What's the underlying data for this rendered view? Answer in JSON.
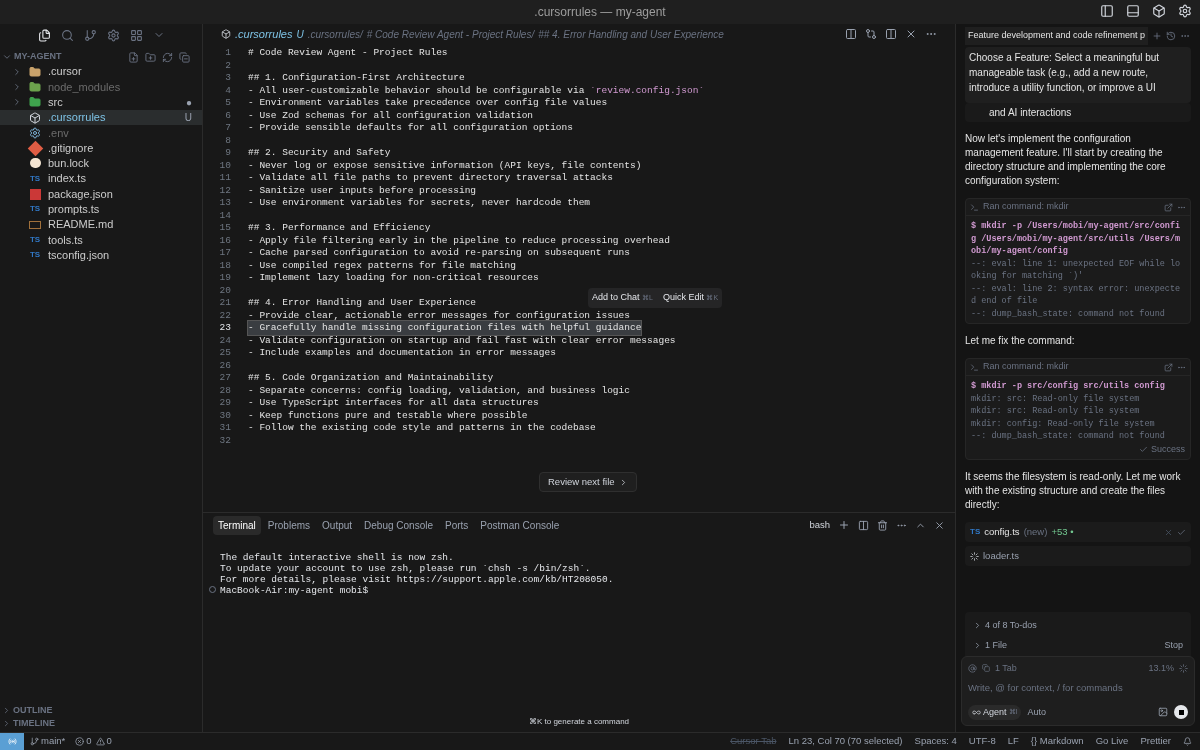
{
  "window": {
    "title": ".cursorrules — my-agent"
  },
  "explorer": {
    "title": "MY-AGENT",
    "items": [
      {
        "name": ".cursor",
        "kind": "folder",
        "selected": false,
        "dimmed": false
      },
      {
        "name": "node_modules",
        "kind": "folder",
        "selected": false,
        "dimmed": true
      },
      {
        "name": "src",
        "kind": "folder",
        "selected": false,
        "dimmed": false,
        "badge": "●"
      },
      {
        "name": ".cursorrules",
        "kind": "file",
        "selected": true,
        "dimmed": false,
        "badge": "U"
      },
      {
        "name": ".env",
        "kind": "file",
        "selected": false,
        "dimmed": true
      },
      {
        "name": ".gitignore",
        "kind": "file",
        "selected": false,
        "dimmed": false
      },
      {
        "name": "bun.lock",
        "kind": "file",
        "selected": false,
        "dimmed": false
      },
      {
        "name": "index.ts",
        "kind": "file",
        "icon_label": "TS",
        "selected": false,
        "dimmed": false
      },
      {
        "name": "package.json",
        "kind": "file",
        "selected": false,
        "dimmed": false
      },
      {
        "name": "prompts.ts",
        "kind": "file",
        "icon_label": "TS",
        "selected": false,
        "dimmed": false
      },
      {
        "name": "README.md",
        "kind": "file",
        "selected": false,
        "dimmed": false
      },
      {
        "name": "tools.ts",
        "kind": "file",
        "icon_label": "TS",
        "selected": false,
        "dimmed": false
      },
      {
        "name": "tsconfig.json",
        "kind": "file",
        "icon_label": "TS",
        "selected": false,
        "dimmed": false
      }
    ],
    "sections": [
      "OUTLINE",
      "TIMELINE"
    ]
  },
  "editor": {
    "tab": {
      "name": ".cursorrules",
      "status": "U"
    },
    "breadcrumb": [
      ".cursorrules/",
      "# Code Review Agent - Project Rules/",
      "## 4. Error Handling and User Experience"
    ],
    "lines": [
      {
        "n": "1",
        "text": "# Code Review Agent - Project Rules",
        "selected": false
      },
      {
        "n": "2",
        "selected": false
      },
      {
        "n": "3",
        "text": "## 1. Configuration-First Architecture",
        "selected": false
      },
      {
        "n": "4",
        "text": "- All user-customizable behavior should be configurable via ",
        "code": "`review.config.json`",
        "selected": false
      },
      {
        "n": "5",
        "text": "- Environment variables take precedence over config file values",
        "selected": false
      },
      {
        "n": "6",
        "text": "- Use Zod schemas for all configuration validation",
        "selected": false
      },
      {
        "n": "7",
        "text": "- Provide sensible defaults for all configuration options",
        "selected": false
      },
      {
        "n": "8",
        "selected": false
      },
      {
        "n": "9",
        "text": "## 2. Security and Safety",
        "selected": false
      },
      {
        "n": "10",
        "text": "- Never log or expose sensitive information (API keys, file contents)",
        "selected": false
      },
      {
        "n": "11",
        "text": "- Validate all file paths to prevent directory traversal attacks",
        "selected": false
      },
      {
        "n": "12",
        "text": "- Sanitize user inputs before processing",
        "selected": false
      },
      {
        "n": "13",
        "text": "- Use environment variables for secrets, never hardcode them",
        "selected": false
      },
      {
        "n": "14",
        "selected": false
      },
      {
        "n": "15",
        "text": "## 3. Performance and Efficiency",
        "selected": false
      },
      {
        "n": "16",
        "text": "- Apply file filtering early in the pipeline to reduce processing overhead",
        "selected": false
      },
      {
        "n": "17",
        "text": "- Cache parsed configuration to avoid re-parsing on subsequent runs",
        "selected": false
      },
      {
        "n": "18",
        "text": "- Use compiled regex patterns for file matching",
        "selected": false
      },
      {
        "n": "19",
        "text": "- Implement lazy loading for non-critical resources",
        "selected": false
      },
      {
        "n": "20",
        "selected": false
      },
      {
        "n": "21",
        "text": "## 4. Error Handling and User Experience",
        "selected": false
      },
      {
        "n": "22",
        "text": "- Provide clear, actionable error messages for configuration issues",
        "selected": false
      },
      {
        "n": "23",
        "text": "- Gracefully handle missing configuration files with helpful guidance",
        "selected": true
      },
      {
        "n": "24",
        "text": "- Validate configuration on startup and fail fast with clear error messages",
        "selected": false
      },
      {
        "n": "25",
        "text": "- Include examples and documentation in error messages",
        "selected": false
      },
      {
        "n": "26",
        "selected": false
      },
      {
        "n": "27",
        "text": "## 5. Code Organization and Maintainability",
        "selected": false
      },
      {
        "n": "28",
        "text": "- Separate concerns: config loading, validation, and business logic",
        "selected": false
      },
      {
        "n": "29",
        "text": "- Use TypeScript interfaces for all data structures",
        "selected": false
      },
      {
        "n": "30",
        "text": "- Keep functions pure and testable where possible",
        "selected": false
      },
      {
        "n": "31",
        "text": "- Follow the existing code style and patterns in the codebase",
        "selected": false
      },
      {
        "n": "32",
        "selected": false
      }
    ],
    "selection_menu": [
      {
        "label": "Add to Chat",
        "key": "⌘L"
      },
      {
        "label": "Quick Edit",
        "key": "⌘K"
      }
    ],
    "review_button": "Review next file"
  },
  "panel": {
    "tabs": [
      {
        "label": "Terminal",
        "selected": true
      },
      {
        "label": "Problems",
        "selected": false
      },
      {
        "label": "Output",
        "selected": false
      },
      {
        "label": "Debug Console",
        "selected": false
      },
      {
        "label": "Ports",
        "selected": false
      },
      {
        "label": "Postman Console",
        "selected": false
      }
    ],
    "shell": "bash",
    "output": [
      "The default interactive shell is now zsh.",
      "To update your account to use zsh, please run `chsh -s /bin/zsh`.",
      "For more details, please visit https://support.apple.com/kb/HT208050."
    ],
    "prompt": "MacBook-Air:my-agent mobi$",
    "hint": "⌘K to generate a command"
  },
  "chat": {
    "title": "Feature development and code refinement p",
    "todo_card": "Choose a Feature: Select a meaningful but manageable task (e.g., add a new route, introduce a utility function, or improve a UI",
    "todo_tail": "and AI interactions",
    "blocks": [
      {
        "kind": "text",
        "text": "Now let's implement the configuration management feature. I'll start by creating the directory structure and implementing the core configuration system:"
      },
      {
        "kind": "command",
        "title": "Ran command: mkdir",
        "command": "$ mkdir -p /Users/mobi/my-agent/src/config /Users/mobi/my-agent/src/utils /Users/mobi/my-agent/config",
        "output": [
          "--: eval: line 1: unexpected EOF while looking for matching `)'",
          "--: eval: line 2: syntax error: unexpected end of file",
          "--: dump_bash_state: command not found"
        ]
      },
      {
        "kind": "text",
        "text": "Let me fix the command:"
      },
      {
        "kind": "command",
        "title": "Ran command: mkdir",
        "command": "$ mkdir -p src/config src/utils config",
        "output": [
          "mkdir: src: Read-only file system",
          "mkdir: src: Read-only file system",
          "mkdir: config: Read-only file system",
          "--: dump_bash_state: command not found"
        ],
        "status": "Success"
      },
      {
        "kind": "text",
        "text": "It seems the filesystem is read-only. Let me work with the existing structure and create the files directly:"
      },
      {
        "kind": "file",
        "icon_label": "TS",
        "name": "config.ts",
        "note": "(new)",
        "diff": "+53 •"
      },
      {
        "kind": "loading",
        "name": "loader.ts"
      }
    ],
    "todos": "4 of 8 To-dos",
    "files": "1 File",
    "stop": "Stop",
    "context": "1 Tab",
    "usage": "13.1%",
    "input": {
      "placeholder": "Write, @ for context, / for commands"
    },
    "mode": "Agent",
    "mode_key": "⌘I",
    "model": "Auto"
  },
  "status_bar": {
    "branch": "main*",
    "errors": "0",
    "warnings": "0",
    "items": [
      "Cursor Tab",
      "Ln 23, Col 70 (70 selected)",
      "Spaces: 4",
      "UTF-8",
      "LF",
      "{} Markdown",
      "Go Live",
      "Prettier"
    ]
  }
}
